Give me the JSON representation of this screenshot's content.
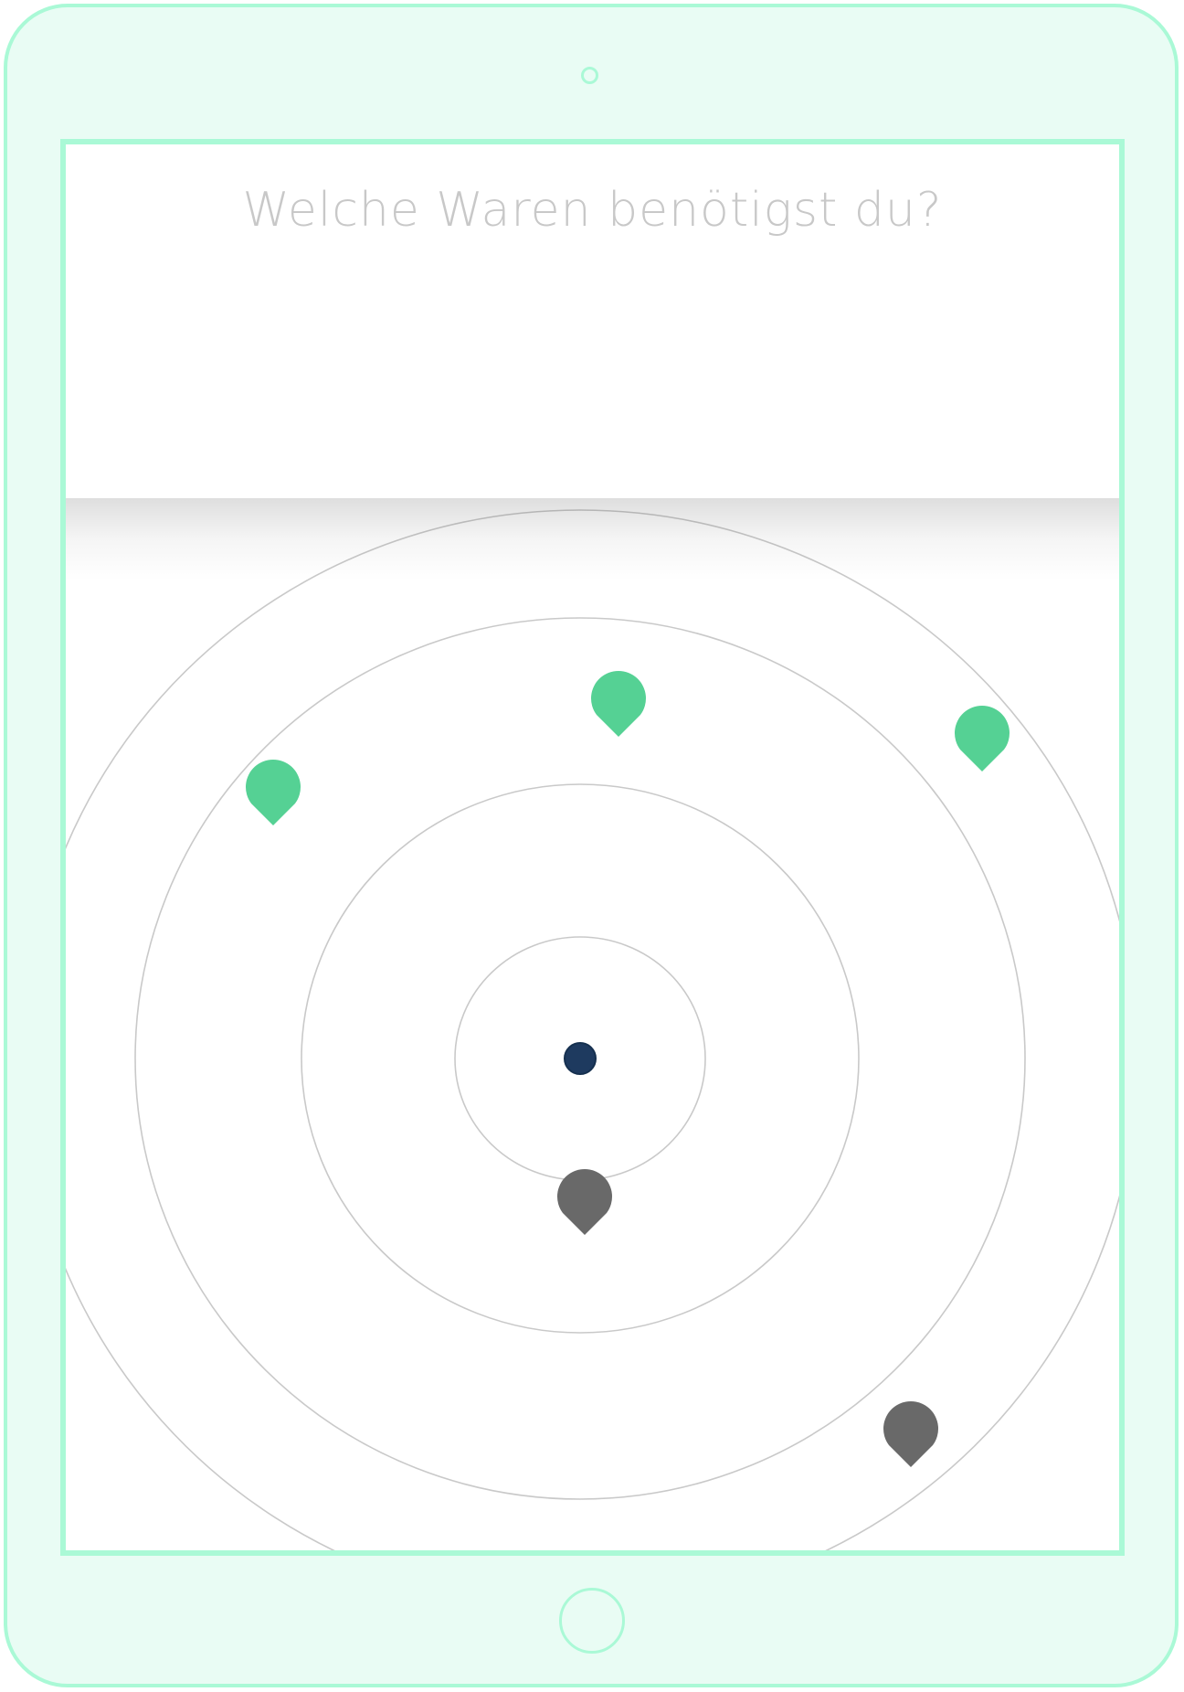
{
  "header": {
    "title": "Welche Waren benötigst du?"
  },
  "colors": {
    "device_frame": "#aaf9d6",
    "device_background": "#e9fcf4",
    "title_text": "#c8c8c8",
    "ring_stroke": "#c9c9c9",
    "user_location": "#1e3a5f",
    "available_marker": "#55d194",
    "unavailable_marker": "#696969"
  },
  "radar": {
    "user_location_icon": "location-dot-icon",
    "markers": [
      {
        "status": "available",
        "icon": "map-pin-icon"
      },
      {
        "status": "available",
        "icon": "map-pin-icon"
      },
      {
        "status": "available",
        "icon": "map-pin-icon"
      },
      {
        "status": "unavailable",
        "icon": "map-pin-icon"
      },
      {
        "status": "unavailable",
        "icon": "map-pin-icon"
      }
    ]
  }
}
